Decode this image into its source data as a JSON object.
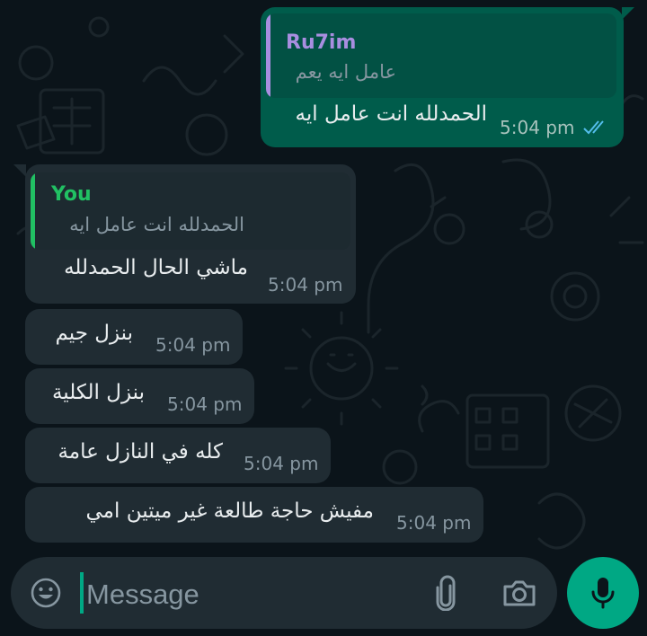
{
  "conversation": {
    "messages": [
      {
        "direction": "outgoing",
        "quote": {
          "author": "Ru7im",
          "text": "عامل ايه يعم"
        },
        "text": "الحمدلله انت عامل ايه",
        "time": "5:04 pm",
        "status_icon": "double-check-read-icon"
      },
      {
        "direction": "incoming",
        "quote": {
          "author": "You",
          "text": "الحمدلله انت عامل ايه"
        },
        "text": "ماشي الحال الحمدلله",
        "time": "5:04 pm"
      },
      {
        "direction": "incoming",
        "text": "بنزل جيم",
        "time": "5:04 pm"
      },
      {
        "direction": "incoming",
        "text": "بنزل الكلية",
        "time": "5:04 pm"
      },
      {
        "direction": "incoming",
        "text": "كله في النازل عامة",
        "time": "5:04 pm"
      },
      {
        "direction": "incoming",
        "text": "مفيش حاجة طالعة غير ميتين امي",
        "time": "5:04 pm"
      }
    ]
  },
  "composer": {
    "placeholder": "Message",
    "value": "",
    "left_icon": "emoji-icon",
    "attach_icon": "paperclip-icon",
    "camera_icon": "camera-icon",
    "send_icon": "microphone-icon"
  },
  "colors": {
    "background": "#0b141a",
    "outgoing_bubble": "#005c4b",
    "incoming_bubble": "#202c33",
    "quote_author_other": "#a88ee0",
    "quote_author_you": "#21c063",
    "read_ticks": "#53bdeb",
    "accent": "#00a884"
  }
}
